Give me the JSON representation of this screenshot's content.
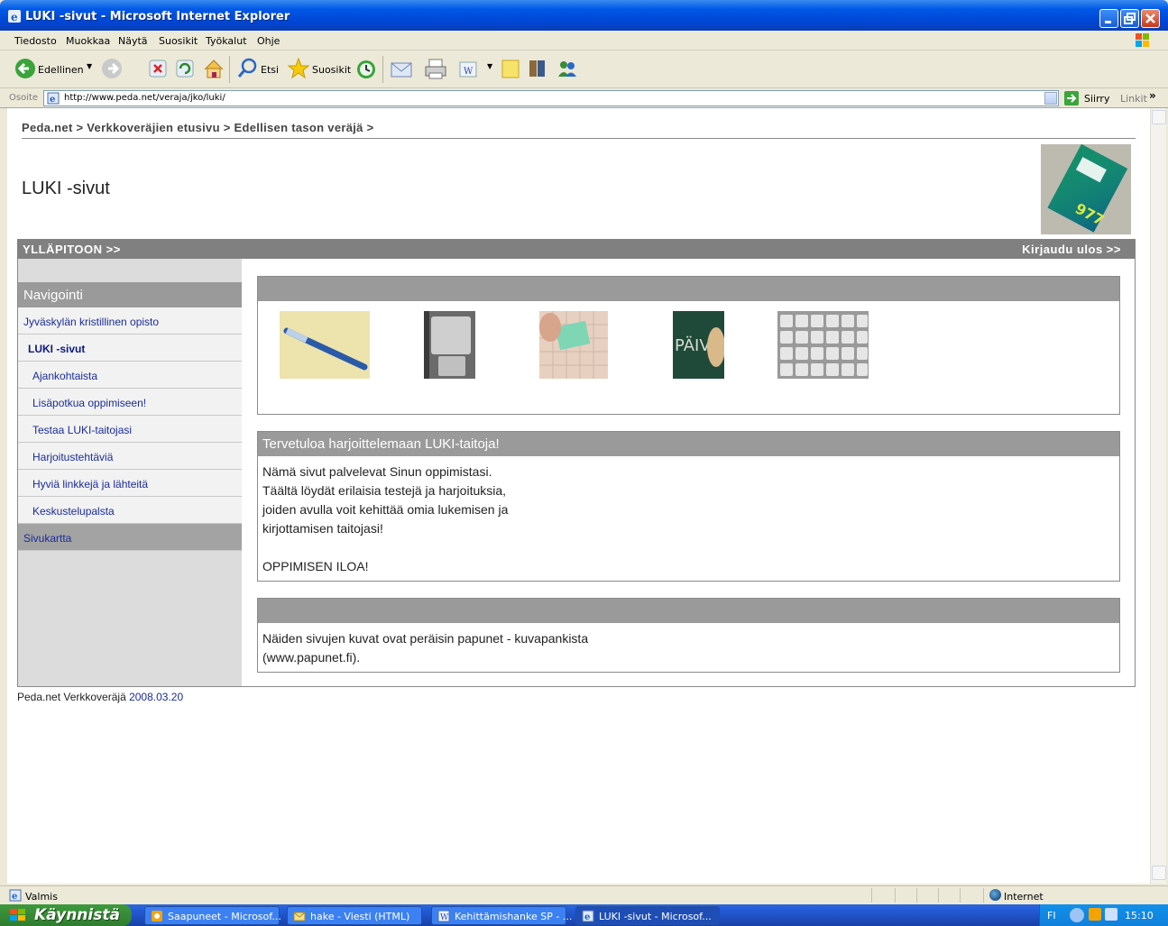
{
  "window": {
    "title": "LUKI -sivut - Microsoft Internet Explorer"
  },
  "menu": [
    "Tiedosto",
    "Muokkaa",
    "Näytä",
    "Suosikit",
    "Työkalut",
    "Ohje"
  ],
  "toolbar": {
    "back": "Edellinen",
    "search": "Etsi",
    "favorites": "Suosikit"
  },
  "address": {
    "label": "Osoite",
    "url": "http://www.peda.net/veraja/jko/luki/",
    "go": "Siirry",
    "links": "Linkit"
  },
  "page": {
    "breadcrumb": "Peda.net > Verkkoveräjien etusivu > Edellisen tason veräjä >",
    "title": "LUKI -sivut",
    "admin": "YLLÄPITOON >>",
    "logout": "Kirjaudu ulos >>",
    "nav": {
      "header": "Navigointi",
      "items": [
        "Jyväskylän kristillinen opisto",
        "LUKI -sivut",
        "Ajankohtaista",
        "Lisäpotkua oppimiseen!",
        "Testaa LUKI-taitojasi",
        "Harjoitustehtäviä",
        "Hyviä linkkejä ja lähteitä",
        "Keskustelupalsta",
        "Sivukartta"
      ]
    },
    "welcome": {
      "title": "Tervetuloa harjoittelemaan LUKI-taitoja!",
      "lines": [
        "Nämä sivut palvelevat Sinun oppimistasi.",
        "Täältä löydät erilaisia testejä ja harjoituksia,",
        "joiden avulla voit kehittää omia lukemisen ja",
        "kirjottamisen taitojasi!",
        "OPPIMISEN ILOA!"
      ]
    },
    "credits": {
      "lines": [
        "Näiden sivujen kuvat ovat peräisin papunet - kuvapankista",
        "(www.papunet.fi)."
      ]
    },
    "footer": {
      "text": "Peda.net Verkkoveräjä ",
      "date": "2008.03.20"
    }
  },
  "status": {
    "text": "Valmis",
    "zone": "Internet"
  },
  "taskbar": {
    "start": "Käynnistä",
    "tasks": [
      "Saapuneet - Microsof...",
      "hake - Viesti (HTML)",
      "Kehittämishanke SP - ...",
      "LUKI -sivut - Microsof..."
    ],
    "lang": "FI",
    "clock": "15:10"
  }
}
